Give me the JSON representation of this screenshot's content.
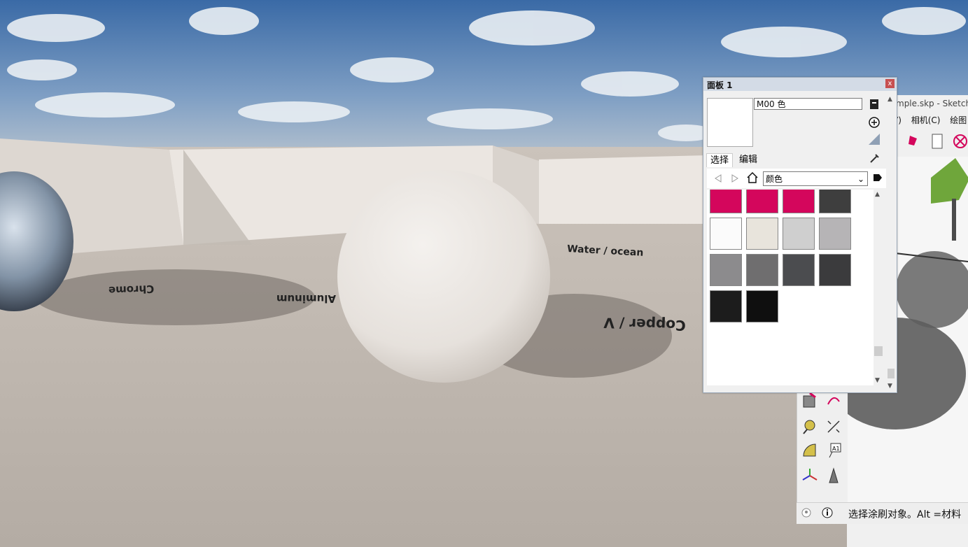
{
  "background_window": {
    "title": "mple.skp - Sketch",
    "menu": [
      "V)",
      "相机(C)",
      "绘图"
    ]
  },
  "panel": {
    "title": "面板 1",
    "close_label": "x",
    "material_name": "M00 色",
    "tabs": [
      {
        "label": "选择",
        "active": true
      },
      {
        "label": "编辑",
        "active": false
      }
    ],
    "library_dropdown": "颜色",
    "swatches": [
      {
        "color": "#d4065c"
      },
      {
        "color": "#d4065c"
      },
      {
        "color": "#d4065c"
      },
      {
        "color": "#3e3e3e"
      },
      {
        "color": "#fbfbfb"
      },
      {
        "color": "#e8e4dc"
      },
      {
        "color": "#cfcfcf"
      },
      {
        "color": "#b6b4b6"
      },
      {
        "color": "#8c8b8d"
      },
      {
        "color": "#6f6e6f"
      },
      {
        "color": "#4b4c4f"
      },
      {
        "color": "#3b3b3d"
      },
      {
        "color": "#1c1c1c"
      },
      {
        "color": "#0f0f0f"
      }
    ]
  },
  "statusbar": {
    "text": "选择涂刷对象。Alt =材料"
  },
  "scene_labels": {
    "water": "Water / ocean",
    "copper": "Copper / V",
    "aluminum": "Aluminum",
    "chrome": "Chrome"
  },
  "colors": {
    "sky_top": "#3d6ea8",
    "ground": "#bdb5ad",
    "wall": "#e6e1dc",
    "accent_pink": "#d4065c"
  }
}
